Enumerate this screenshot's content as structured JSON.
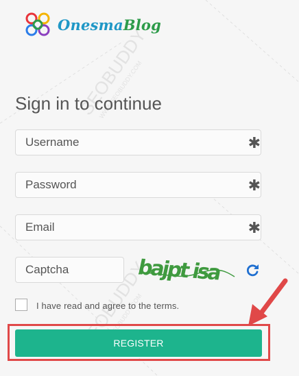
{
  "brand": {
    "part1": "Onesma",
    "part2": "Blog"
  },
  "form": {
    "title": "Sign in to continue",
    "username_placeholder": "Username",
    "password_placeholder": "Password",
    "email_placeholder": "Email",
    "captcha_placeholder": "Captcha",
    "required_mark": "✱",
    "captcha_text": "bajpt isa",
    "terms_label": "I have read and agree to the terms.",
    "register_label": "REGISTER"
  },
  "watermark": {
    "text": "SEOBUDDY",
    "subtext": "WWW.SEOBUDDY.COM"
  },
  "colors": {
    "accent": "#1db48d",
    "annotation": "#e04848",
    "refresh": "#1f6fd0"
  },
  "icons": {
    "refresh": "refresh-icon",
    "arrow": "annotation-arrow",
    "logo": "logo-icon"
  }
}
